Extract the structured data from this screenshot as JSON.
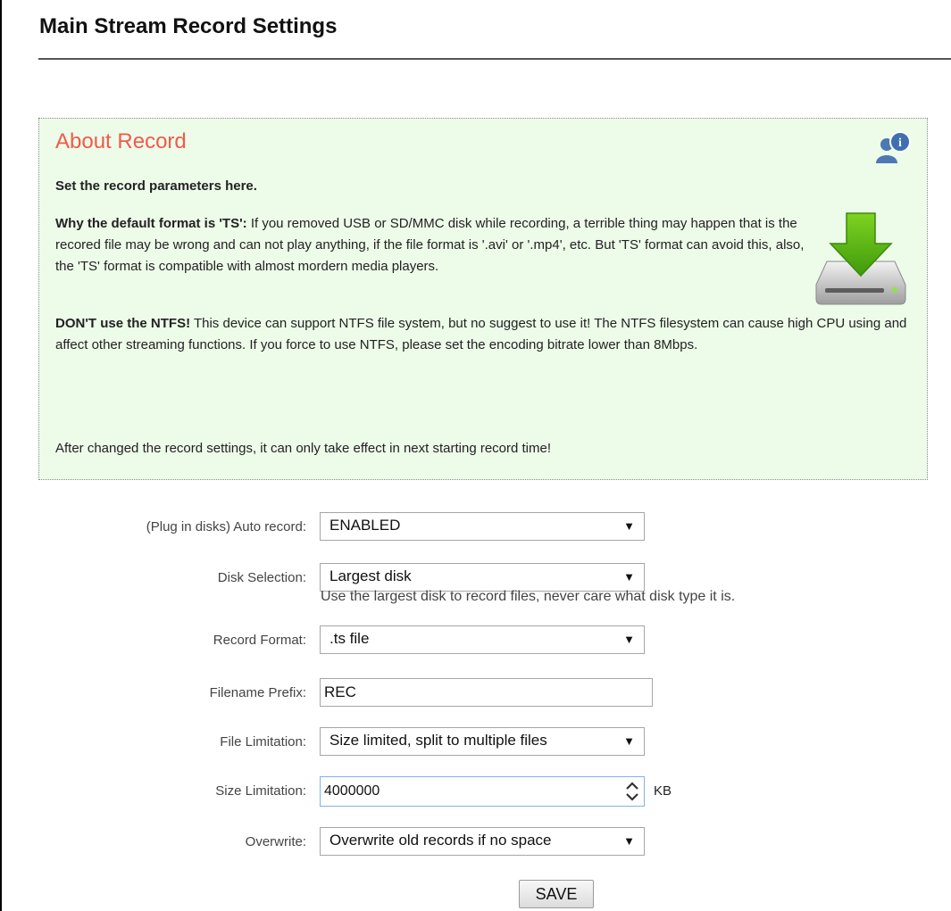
{
  "page": {
    "title": "Main Stream Record Settings"
  },
  "about": {
    "title": "About Record",
    "subtitle": "Set the record parameters here.",
    "p1_bold": "Why the default format is 'TS':",
    "p1_text": " If you removed USB or SD/MMC disk while recording, a terrible thing may happen that is the recored file may be wrong and can not play anything, if the file format is '.avi' or '.mp4', etc. But 'TS' format can avoid this, also, the 'TS' format is compatible with almost mordern media players.",
    "p2_bold": "DON'T use the NTFS!",
    "p2_text": " This device can support NTFS file system, but no suggest to use it! The NTFS filesystem can cause high CPU using and affect other streaming functions. If you force to use NTFS, please set the encoding bitrate lower than 8Mbps.",
    "p3_text": "After changed the record settings, it can only take effect in next starting record time!",
    "info_icon": "user-info-icon",
    "drive_icon": "download-drive-icon"
  },
  "form": {
    "auto_record": {
      "label": "(Plug in disks) Auto record:",
      "value": "ENABLED"
    },
    "disk_selection": {
      "label": "Disk Selection:",
      "value": "Largest disk",
      "help": "Use the largest disk to record files, never care what disk type it is."
    },
    "record_format": {
      "label": "Record Format:",
      "value": ".ts file"
    },
    "filename_prefix": {
      "label": "Filename Prefix:",
      "value": "REC"
    },
    "file_limitation": {
      "label": "File Limitation:",
      "value": "Size limited, split to multiple files"
    },
    "size_limitation": {
      "label": "Size Limitation:",
      "value": "4000000",
      "unit": "KB"
    },
    "overwrite": {
      "label": "Overwrite:",
      "value": "Overwrite old records if no space"
    },
    "caret": "▼",
    "save_label": "SAVE"
  },
  "colors": {
    "about_bg": "#edfbe9",
    "about_title": "#f15a4a",
    "icon_green": "#58b81a"
  }
}
